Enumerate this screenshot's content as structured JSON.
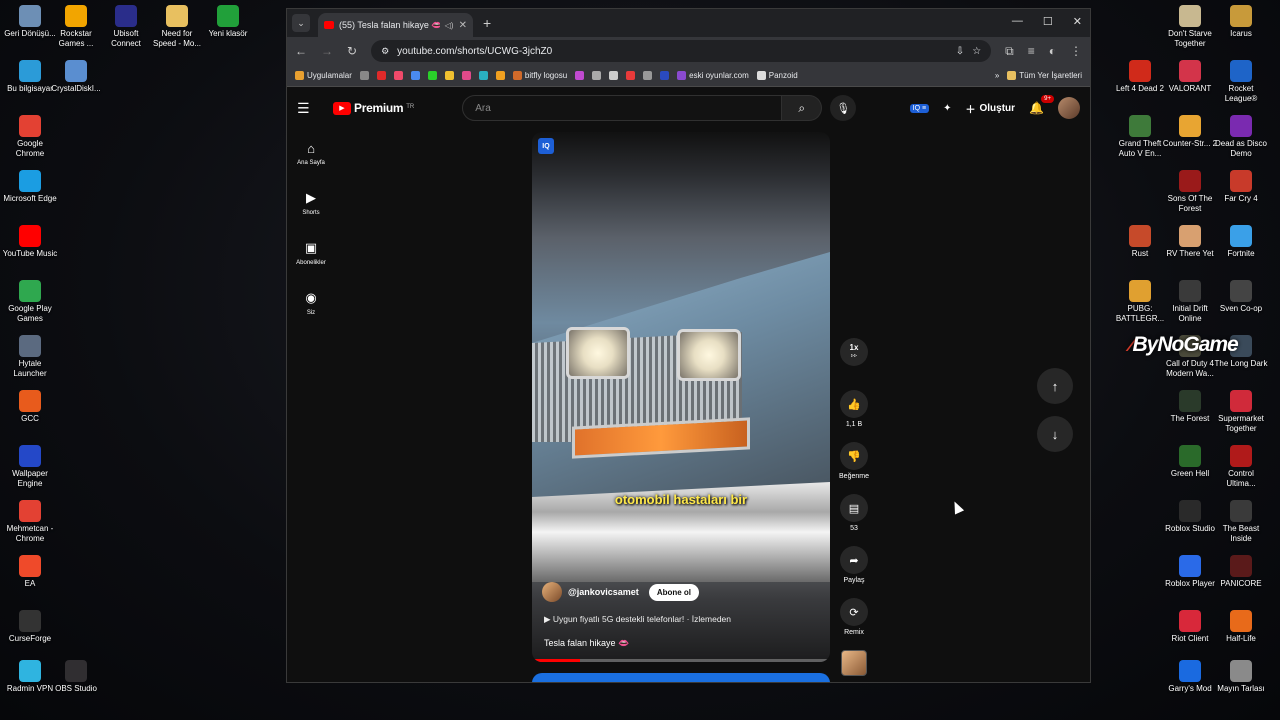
{
  "desktop_left": [
    {
      "label": "Geri Dönüşü...",
      "icon": "recycle-bin-icon",
      "color": "#6d8fb5"
    },
    {
      "label": "Rockstar Games ...",
      "icon": "rockstar-icon",
      "color": "#f2a500"
    },
    {
      "label": "Ubisoft Connect",
      "icon": "ubisoft-icon",
      "color": "#2a2d8a"
    },
    {
      "label": "Need for Speed - Mo...",
      "icon": "folder-icon",
      "color": "#e8c060"
    },
    {
      "label": "Yeni klasör",
      "icon": "tree-icon",
      "color": "#21a03a"
    },
    {
      "label": "Bu bilgisayar",
      "icon": "computer-icon",
      "color": "#2b9bd8"
    },
    {
      "label": "CrystalDiskI...",
      "icon": "crystaldisk-icon",
      "color": "#5a8ed0"
    },
    {
      "label": "Google Chrome",
      "icon": "chrome-icon",
      "color": "#e34133"
    },
    {
      "label": "Microsoft Edge",
      "icon": "edge-icon",
      "color": "#1b9de2"
    },
    {
      "label": "YouTube Music",
      "icon": "youtube-music-icon",
      "color": "#f00"
    },
    {
      "label": "Google Play Games",
      "icon": "play-games-icon",
      "color": "#2fa84f"
    },
    {
      "label": "Hytale Launcher",
      "icon": "hytale-icon",
      "color": "#5b6a80"
    },
    {
      "label": "GCC",
      "icon": "gcc-icon",
      "color": "#e85b1c"
    },
    {
      "label": "Wallpaper Engine",
      "icon": "wallpaper-engine-icon",
      "color": "#2448c8"
    },
    {
      "label": "Mehmetcan - Chrome",
      "icon": "chrome-profile-icon",
      "color": "#e34133"
    },
    {
      "label": "EA",
      "icon": "ea-icon",
      "color": "#ef4a2a"
    },
    {
      "label": "CurseForge",
      "icon": "curseforge-icon",
      "color": "#333"
    },
    {
      "label": "Radmin VPN",
      "icon": "radmin-icon",
      "color": "#2fb4e0"
    },
    {
      "label": "OBS Studio",
      "icon": "obs-icon",
      "color": "#302e31"
    }
  ],
  "desktop_right": [
    {
      "label": "Don't Starve Together",
      "icon": "dont-starve-icon",
      "color": "#c8b890"
    },
    {
      "label": "Icarus",
      "icon": "icarus-icon",
      "color": "#c89a3a"
    },
    {
      "label": "Left 4 Dead 2",
      "icon": "l4d2-icon",
      "color": "#d02a1a"
    },
    {
      "label": "VALORANT",
      "icon": "valorant-icon",
      "color": "#d3344a"
    },
    {
      "label": "Rocket League®",
      "icon": "rocket-league-icon",
      "color": "#1e64c8"
    },
    {
      "label": "Grand Theft Auto V En...",
      "icon": "gta-icon",
      "color": "#3e7a3a"
    },
    {
      "label": "Counter-Str... 2",
      "icon": "cs2-icon",
      "color": "#e8a532"
    },
    {
      "label": "Dead as Disco Demo",
      "icon": "dead-as-disco-icon",
      "color": "#7a2ab0"
    },
    {
      "label": "Sons Of The Forest",
      "icon": "sons-forest-icon",
      "color": "#9a1a1a"
    },
    {
      "label": "Far Cry 4",
      "icon": "farcry-icon",
      "color": "#c83a2a"
    },
    {
      "label": "Rust",
      "icon": "rust-icon",
      "color": "#c64a2a"
    },
    {
      "label": "RV There Yet",
      "icon": "rv-there-yet-icon",
      "color": "#d8a070"
    },
    {
      "label": "Fortnite",
      "icon": "fortnite-icon",
      "color": "#3aa0e8"
    },
    {
      "label": "PUBG: BATTLEGR...",
      "icon": "pubg-icon",
      "color": "#e0a030"
    },
    {
      "label": "Initial Drift Online",
      "icon": "initial-drift-icon",
      "color": "#3a3a3a"
    },
    {
      "label": "Sven Co-op",
      "icon": "sven-coop-icon",
      "color": "#444"
    },
    {
      "label": "Call of Duty 4 Modern Wa...",
      "icon": "cod4-icon",
      "color": "#4a4a3a"
    },
    {
      "label": "The Long Dark",
      "icon": "long-dark-icon",
      "color": "#3a4a5a"
    },
    {
      "label": "The Forest",
      "icon": "the-forest-icon",
      "color": "#2a3a2a"
    },
    {
      "label": "Supermarket Together",
      "icon": "supermarket-icon",
      "color": "#d02a3a"
    },
    {
      "label": "Green Hell",
      "icon": "green-hell-icon",
      "color": "#2a6a2a"
    },
    {
      "label": "Control Ultima...",
      "icon": "control-icon",
      "color": "#b01a1a"
    },
    {
      "label": "Roblox Studio",
      "icon": "roblox-studio-icon",
      "color": "#2a2a2a"
    },
    {
      "label": "The Beast Inside",
      "icon": "beast-inside-icon",
      "color": "#3a3a3a"
    },
    {
      "label": "Roblox Player",
      "icon": "roblox-icon",
      "color": "#2a6ae8"
    },
    {
      "label": "PANICORE",
      "icon": "panicore-icon",
      "color": "#5a1a1a"
    },
    {
      "label": "Riot Client",
      "icon": "riot-icon",
      "color": "#d8283a"
    },
    {
      "label": "Half-Life",
      "icon": "half-life-icon",
      "color": "#e86a1a"
    },
    {
      "label": "Garry's Mod",
      "icon": "garrys-mod-icon",
      "color": "#1a6ae0"
    },
    {
      "label": "Mayın Tarlası",
      "icon": "minesweeper-icon",
      "color": "#8a8a8a"
    }
  ],
  "brand_overlay": {
    "prefix": "By",
    "name": "NoGame"
  },
  "browser": {
    "tab_title": "(55) Tesla falan hikaye 👄",
    "url": "youtube.com/shorts/UCWG-3jchZ0",
    "bookmarks": {
      "apps": "Uygulamalar",
      "bitfly": "bitfly logosu",
      "eski": "eski oyunlar.com",
      "panzoid": "Panzoid",
      "all": "Tüm Yer İşaretleri"
    }
  },
  "youtube": {
    "logo_text": "Premium",
    "country": "TR",
    "search_placeholder": "Ara",
    "create_label": "Oluştur",
    "notif_count": "9+",
    "guide": [
      {
        "label": "Ana Sayfa",
        "icon": "home-icon",
        "glyph": "⌂"
      },
      {
        "label": "Shorts",
        "icon": "shorts-icon",
        "glyph": "▶"
      },
      {
        "label": "Abonelikler",
        "icon": "subscriptions-icon",
        "glyph": "▣"
      },
      {
        "label": "Siz",
        "icon": "you-icon",
        "glyph": "◉"
      }
    ],
    "short": {
      "caption": "otomobil hastaları bir",
      "channel": "@jankovicsamet",
      "subscribe": "Abone ol",
      "promo": "▶  Uygun fiyatlı 5G destekli telefonlar! · İzlemeden",
      "title": "Tesla falan hikaye 👄",
      "progress": 0.16
    },
    "actions": {
      "speed": "1x",
      "likes": "1,1 B",
      "dislike": "Beğenme",
      "comments": "53",
      "share": "Paylaş",
      "remix": "Remix"
    }
  }
}
